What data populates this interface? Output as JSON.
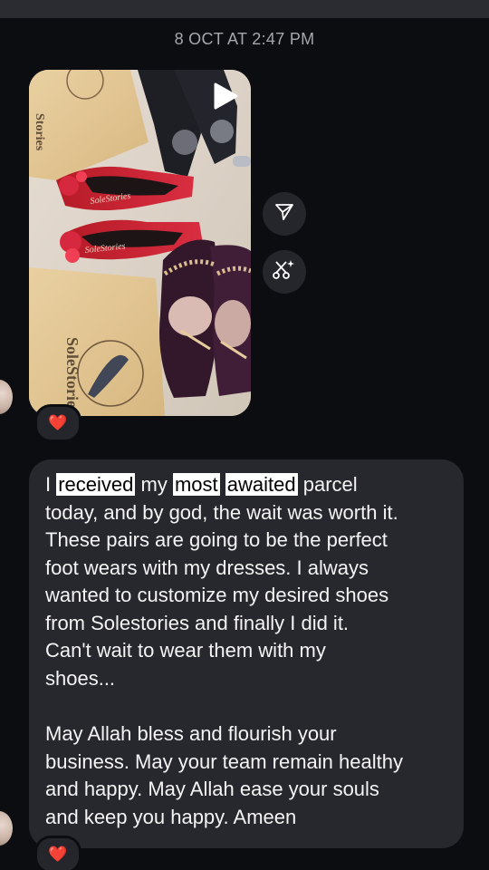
{
  "chat": {
    "timestamp": "8 OCT AT 2:47 PM",
    "media": {
      "type": "video",
      "box_brand_top": "Stories",
      "box_brand_bottom": "SoleStories",
      "shoe_insole_brand": "SoleStories",
      "reaction": "❤️"
    },
    "side_actions": [
      {
        "icon": "share-icon"
      },
      {
        "icon": "sparkle-cut-icon"
      }
    ],
    "message": {
      "line1": [
        "I ",
        "received",
        " my ",
        "most",
        " ",
        "awaited",
        " parcel"
      ],
      "lines": [
        "today, and by god, the wait was worth it.",
        "These pairs are going to be the perfect",
        "foot wears with my dresses. I always",
        "wanted to customize my desired shoes",
        "from Solestories and finally I did it.",
        "Can't wait to wear them with my",
        "shoes..."
      ],
      "lines2": [
        "May Allah bless and flourish your",
        "business. May your team remain healthy",
        "and happy. May Allah ease your souls",
        "and keep you happy. Ameen"
      ],
      "reaction": "❤️"
    }
  }
}
